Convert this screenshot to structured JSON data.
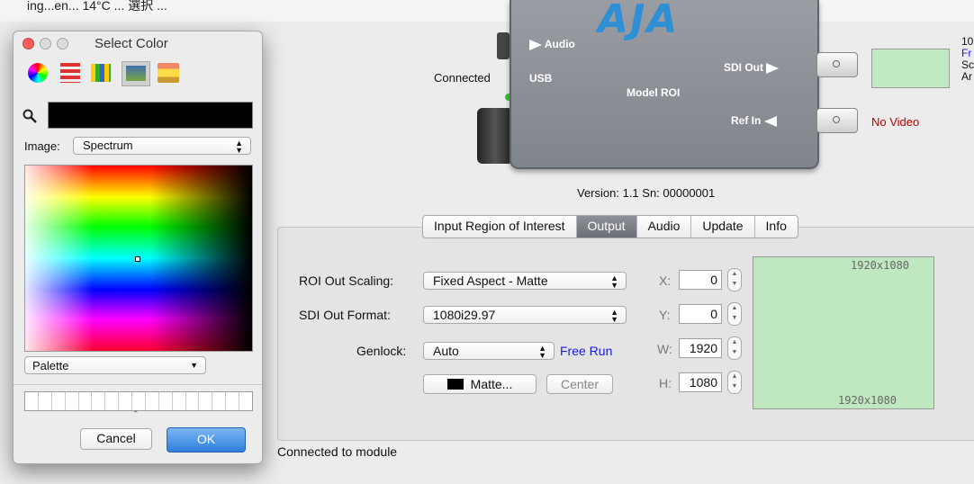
{
  "top_caption": "ing...en... 14°C ... 選択 ...",
  "device": {
    "brand": "AJA",
    "audio_label": "Audio",
    "usb_label": "USB",
    "model_label": "Model ROI",
    "sdi_out_label": "SDI Out",
    "ref_in_label": "Ref In",
    "connected_label": "Connected",
    "no_video": "No Video",
    "right_text": [
      "10",
      "Fr",
      "Sc",
      "Ar"
    ]
  },
  "version_line": "Version: 1.1  Sn: 00000001",
  "tabs": [
    {
      "label": "Input Region of Interest",
      "selected": false
    },
    {
      "label": "Output",
      "selected": true
    },
    {
      "label": "Audio",
      "selected": false
    },
    {
      "label": "Update",
      "selected": false
    },
    {
      "label": "Info",
      "selected": false
    }
  ],
  "output": {
    "roi_out_scaling_label": "ROI Out Scaling:",
    "roi_out_scaling_value": "Fixed Aspect - Matte",
    "sdi_out_format_label": "SDI Out Format:",
    "sdi_out_format_value": "1080i29.97",
    "genlock_label": "Genlock:",
    "genlock_value": "Auto",
    "free_run": "Free Run",
    "matte_button": "Matte...",
    "center_button": "Center",
    "x_label": "X:",
    "x_value": "0",
    "y_label": "Y:",
    "y_value": "0",
    "w_label": "W:",
    "w_value": "1920",
    "h_label": "H:",
    "h_value": "1080",
    "preview_top_res": "1920x1080",
    "preview_bottom_res": "1920x1080"
  },
  "status": "Connected to module",
  "color_picker": {
    "title": "Select Color",
    "image_label": "Image:",
    "image_value": "Spectrum",
    "palette_value": "Palette",
    "cancel": "Cancel",
    "ok": "OK",
    "colors": {
      "preview_green": "#c0e8c0",
      "selected_color": "#000000",
      "ok_blue": "#2d7fdc",
      "free_run_blue": "#1a1adb",
      "no_video_red": "#b00000"
    }
  }
}
